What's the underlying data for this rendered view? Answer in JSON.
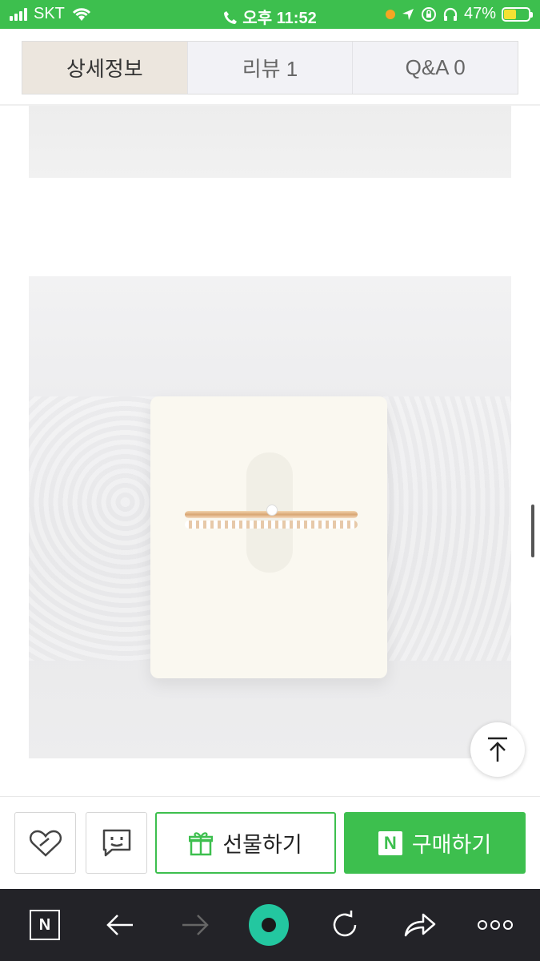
{
  "status": {
    "carrier": "SKT",
    "time": "오후 11:52",
    "battery": "47%",
    "battery_level": 0.47
  },
  "tabs": [
    {
      "label": "상세정보",
      "active": true
    },
    {
      "label": "리뷰  1",
      "active": false
    },
    {
      "label": "Q&A  0",
      "active": false
    }
  ],
  "actions": {
    "gift_label": "선물하기",
    "buy_label": "구매하기",
    "buy_badge": "N"
  },
  "browser": {
    "home_badge": "N"
  },
  "colors": {
    "brand_green": "#3dbf4e",
    "toolbar_dark": "#232328",
    "accent_teal": "#23c7a0"
  },
  "icons": [
    "wifi-icon",
    "phone-icon",
    "location-icon",
    "lock-rotation-icon",
    "headphones-icon",
    "battery-icon",
    "heart-icon",
    "talk-icon",
    "gift-icon",
    "back-arrow-icon",
    "forward-arrow-icon",
    "refresh-icon",
    "share-icon",
    "more-icon",
    "scroll-top-icon"
  ]
}
